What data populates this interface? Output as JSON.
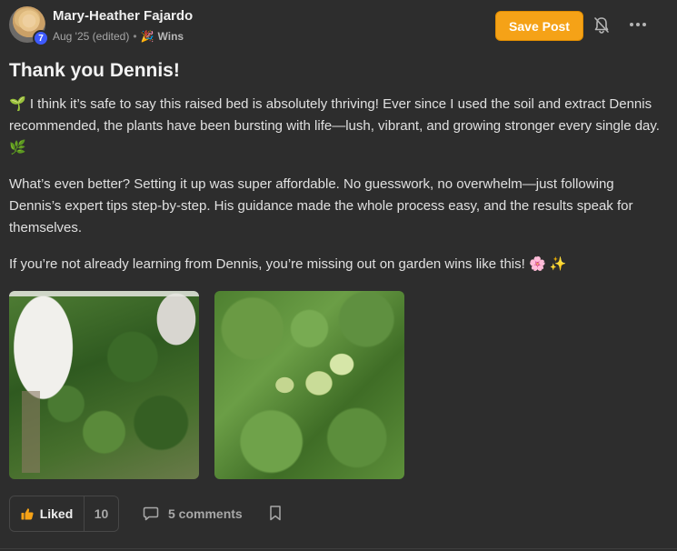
{
  "post": {
    "author": {
      "name": "Mary-Heather Fajardo",
      "level": "7",
      "avatar_icon": "user-avatar"
    },
    "meta": {
      "date": "Aug '25 (edited)",
      "separator": "•",
      "category_icon": "🎉",
      "category": "Wins"
    },
    "actions": {
      "save_label": "Save Post",
      "bell_icon": "bell-icon",
      "more_icon": "more-horizontal-icon"
    },
    "title": "Thank you Dennis!",
    "paragraphs": [
      "🌱 I think it’s safe to say this raised bed is absolutely thriving! Ever since I used the soil and extract Dennis recommended, the plants have been bursting with life—lush, vibrant, and growing stronger every single day. 🌿",
      "What’s even better? Setting it up was super affordable. No guesswork, no overwhelm—just following Dennis’s expert tips step-by-step. His guidance made the whole process easy, and the results speak for themselves.",
      "If you’re not already learning from Dennis, you’re missing out on garden wins like this! 🌸 ✨"
    ],
    "images": [
      {
        "description_icon": "garden-photo"
      },
      {
        "description_icon": "tomato-photo"
      }
    ],
    "footer": {
      "like_label": "Liked",
      "like_count": "10",
      "comments_label": "5 comments",
      "bookmark_icon": "bookmark-icon"
    },
    "colors": {
      "background": "#2d2d2d",
      "accent": "#f5a217",
      "level_badge": "#3d5afe",
      "text": "#e0e0e0",
      "muted": "#a6a6a6"
    }
  }
}
